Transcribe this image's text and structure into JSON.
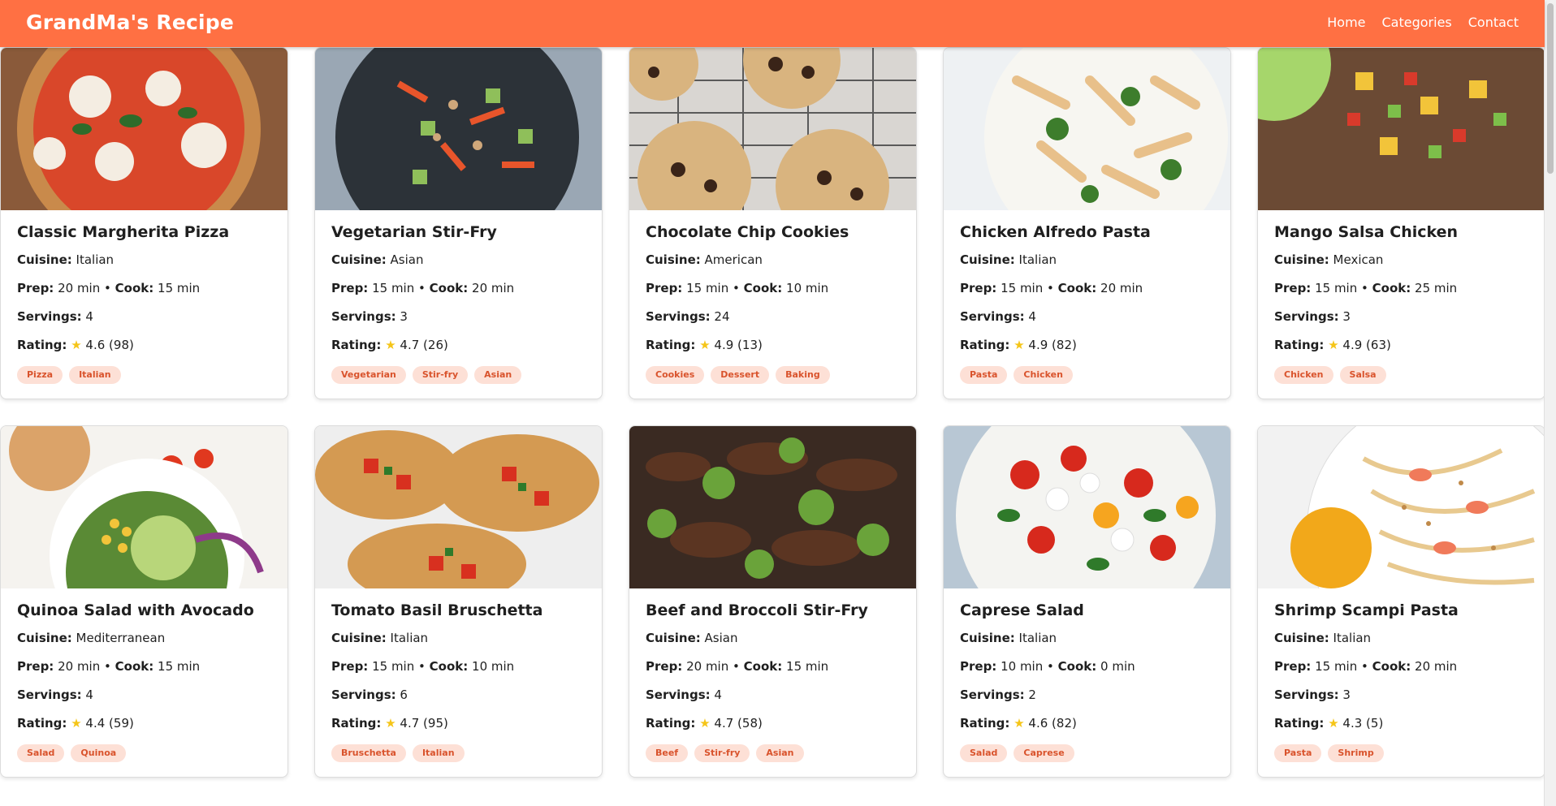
{
  "brand": "GrandMa's Recipe",
  "nav": [
    {
      "label": "Home"
    },
    {
      "label": "Categories"
    },
    {
      "label": "Contact"
    }
  ],
  "labels": {
    "cuisine": "Cuisine:",
    "prep": "Prep:",
    "cook": "Cook:",
    "servings": "Servings:",
    "rating": "Rating:",
    "star": "★",
    "bullet": "•"
  },
  "colors": {
    "brand": "#ff7043",
    "tag_bg": "#fde0d6",
    "tag_text": "#d9532c",
    "star": "#f5c518"
  },
  "recipes": [
    {
      "title": "Classic Margherita Pizza",
      "cuisine": "Italian",
      "prep": "20 min",
      "cook": "15 min",
      "servings": "4",
      "rating": "4.6 (98)",
      "tags": [
        "Pizza",
        "Italian"
      ],
      "image": "margherita-pizza-photo"
    },
    {
      "title": "Vegetarian Stir-Fry",
      "cuisine": "Asian",
      "prep": "15 min",
      "cook": "20 min",
      "servings": "3",
      "rating": "4.7 (26)",
      "tags": [
        "Vegetarian",
        "Stir-fry",
        "Asian"
      ],
      "image": "vegetable-stir-fry-photo"
    },
    {
      "title": "Chocolate Chip Cookies",
      "cuisine": "American",
      "prep": "15 min",
      "cook": "10 min",
      "servings": "24",
      "rating": "4.9 (13)",
      "tags": [
        "Cookies",
        "Dessert",
        "Baking"
      ],
      "image": "chocolate-chip-cookies-photo"
    },
    {
      "title": "Chicken Alfredo Pasta",
      "cuisine": "Italian",
      "prep": "15 min",
      "cook": "20 min",
      "servings": "4",
      "rating": "4.9 (82)",
      "tags": [
        "Pasta",
        "Chicken"
      ],
      "image": "chicken-alfredo-pasta-photo"
    },
    {
      "title": "Mango Salsa Chicken",
      "cuisine": "Mexican",
      "prep": "15 min",
      "cook": "25 min",
      "servings": "3",
      "rating": "4.9 (63)",
      "tags": [
        "Chicken",
        "Salsa"
      ],
      "image": "mango-salsa-chicken-photo"
    },
    {
      "title": "Quinoa Salad with Avocado",
      "cuisine": "Mediterranean",
      "prep": "20 min",
      "cook": "15 min",
      "servings": "4",
      "rating": "4.4 (59)",
      "tags": [
        "Salad",
        "Quinoa"
      ],
      "image": "quinoa-avocado-salad-photo"
    },
    {
      "title": "Tomato Basil Bruschetta",
      "cuisine": "Italian",
      "prep": "15 min",
      "cook": "10 min",
      "servings": "6",
      "rating": "4.7 (95)",
      "tags": [
        "Bruschetta",
        "Italian"
      ],
      "image": "tomato-bruschetta-photo"
    },
    {
      "title": "Beef and Broccoli Stir-Fry",
      "cuisine": "Asian",
      "prep": "20 min",
      "cook": "15 min",
      "servings": "4",
      "rating": "4.7 (58)",
      "tags": [
        "Beef",
        "Stir-fry",
        "Asian"
      ],
      "image": "beef-broccoli-photo"
    },
    {
      "title": "Caprese Salad",
      "cuisine": "Italian",
      "prep": "10 min",
      "cook": "0 min",
      "servings": "2",
      "rating": "4.6 (82)",
      "tags": [
        "Salad",
        "Caprese"
      ],
      "image": "caprese-salad-photo"
    },
    {
      "title": "Shrimp Scampi Pasta",
      "cuisine": "Italian",
      "prep": "15 min",
      "cook": "20 min",
      "servings": "3",
      "rating": "4.3 (5)",
      "tags": [
        "Pasta",
        "Shrimp"
      ],
      "image": "shrimp-scampi-pasta-photo"
    }
  ]
}
